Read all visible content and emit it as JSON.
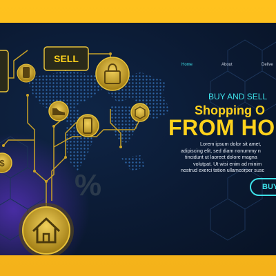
{
  "nav": {
    "items": [
      "Home",
      "About",
      "Delive"
    ],
    "active": "Home"
  },
  "hero": {
    "subtitle": "BUY AND SELL",
    "title_line1": "Shopping O",
    "title_line2": "FROM HO",
    "paragraph": [
      "Lorem ipsum dolor sit amet,",
      "adipiscing elit, sed diam nonummy n",
      "tincidunt ut laoreet dolore magna",
      "volutpat. Ut wisi enim ad minim",
      "nostrud exerci tation ullamcorper susc"
    ],
    "cta_label": "BUY"
  },
  "illustration": {
    "sell_label": "SELL",
    "percent_symbol": "%",
    "icons": [
      "shopping-bag-icon",
      "shoe-icon",
      "smartphone-icon",
      "box-icon",
      "dollar-coin-icon",
      "house-icon"
    ]
  },
  "colors": {
    "frame": "#f7b81c",
    "background": "#0b1a33",
    "accent_cyan": "#3ee3ea",
    "accent_yellow": "#ffd21c",
    "circuit": "#c9a227"
  }
}
